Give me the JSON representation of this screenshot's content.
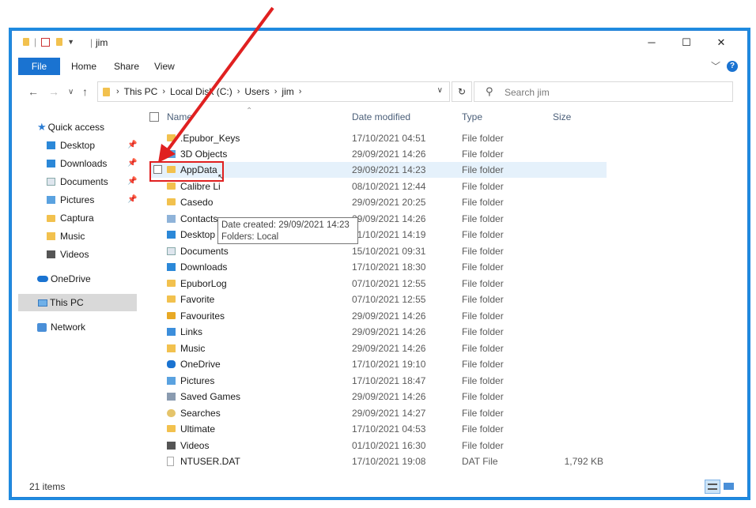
{
  "window": {
    "title": "jim",
    "title_sep": "|",
    "ribbon_tabs": [
      "File",
      "Home",
      "Share",
      "View"
    ],
    "help": "?"
  },
  "nav": {
    "breadcrumb": [
      "This PC",
      "Local Disk (C:)",
      "Users",
      "jim"
    ],
    "search_placeholder": "Search jim"
  },
  "sidebar": {
    "items": [
      {
        "label": "Quick access"
      },
      {
        "label": "Desktop"
      },
      {
        "label": "Downloads"
      },
      {
        "label": "Documents"
      },
      {
        "label": "Pictures"
      },
      {
        "label": "Captura"
      },
      {
        "label": "Music"
      },
      {
        "label": "Videos"
      },
      {
        "label": "OneDrive"
      },
      {
        "label": "This PC"
      },
      {
        "label": "Network"
      }
    ]
  },
  "columns": {
    "name": "Name",
    "date": "Date modified",
    "type": "Type",
    "size": "Size"
  },
  "files": [
    {
      "name": ".Epubor_Keys",
      "date": "17/10/2021 04:51",
      "type": "File folder",
      "size": ""
    },
    {
      "name": "3D Objects",
      "date": "29/09/2021 14:26",
      "type": "File folder",
      "size": ""
    },
    {
      "name": "AppData",
      "date": "29/09/2021 14:23",
      "type": "File folder",
      "size": ""
    },
    {
      "name": "Calibre Li",
      "date": "08/10/2021 12:44",
      "type": "File folder",
      "size": ""
    },
    {
      "name": "Casedo",
      "date": "29/09/2021 20:25",
      "type": "File folder",
      "size": ""
    },
    {
      "name": "Contacts",
      "date": "29/09/2021 14:26",
      "type": "File folder",
      "size": ""
    },
    {
      "name": "Desktop",
      "date": "21/10/2021 14:19",
      "type": "File folder",
      "size": ""
    },
    {
      "name": "Documents",
      "date": "15/10/2021 09:31",
      "type": "File folder",
      "size": ""
    },
    {
      "name": "Downloads",
      "date": "17/10/2021 18:30",
      "type": "File folder",
      "size": ""
    },
    {
      "name": "EpuborLog",
      "date": "07/10/2021 12:55",
      "type": "File folder",
      "size": ""
    },
    {
      "name": "Favorite",
      "date": "07/10/2021 12:55",
      "type": "File folder",
      "size": ""
    },
    {
      "name": "Favourites",
      "date": "29/09/2021 14:26",
      "type": "File folder",
      "size": ""
    },
    {
      "name": "Links",
      "date": "29/09/2021 14:26",
      "type": "File folder",
      "size": ""
    },
    {
      "name": "Music",
      "date": "29/09/2021 14:26",
      "type": "File folder",
      "size": ""
    },
    {
      "name": "OneDrive",
      "date": "17/10/2021 19:10",
      "type": "File folder",
      "size": ""
    },
    {
      "name": "Pictures",
      "date": "17/10/2021 18:47",
      "type": "File folder",
      "size": ""
    },
    {
      "name": "Saved Games",
      "date": "29/09/2021 14:26",
      "type": "File folder",
      "size": ""
    },
    {
      "name": "Searches",
      "date": "29/09/2021 14:27",
      "type": "File folder",
      "size": ""
    },
    {
      "name": "Ultimate",
      "date": "17/10/2021 04:53",
      "type": "File folder",
      "size": ""
    },
    {
      "name": "Videos",
      "date": "01/10/2021 16:30",
      "type": "File folder",
      "size": ""
    },
    {
      "name": "NTUSER.DAT",
      "date": "17/10/2021 19:08",
      "type": "DAT File",
      "size": "1,792 KB"
    }
  ],
  "tooltip": {
    "line1": "Date created: 29/09/2021 14:23",
    "line2": "Folders: Local"
  },
  "status": {
    "items": "21 items"
  },
  "colors": {
    "accent": "#1a73d1",
    "annotation": "#e02020",
    "hover_row": "#e5f1fb"
  }
}
